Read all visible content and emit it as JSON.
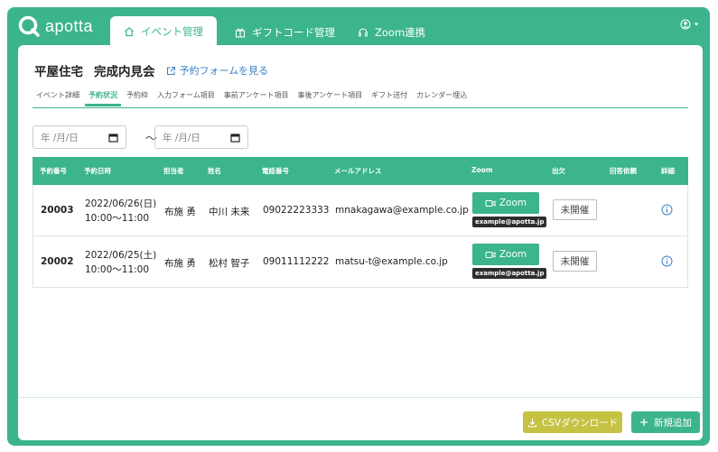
{
  "brand": {
    "name": "apotta"
  },
  "nav": {
    "tabs": [
      {
        "label": "イベント管理",
        "icon": "home-icon",
        "active": true
      },
      {
        "label": "ギフトコード管理",
        "icon": "gift-icon",
        "active": false
      },
      {
        "label": "Zoom連携",
        "icon": "headset-icon",
        "active": false
      }
    ]
  },
  "page": {
    "title": "平屋住宅",
    "title2": "完成内見会",
    "form_link": "予約フォームを見る"
  },
  "subtabs": [
    {
      "label": "イベント詳細",
      "active": false
    },
    {
      "label": "予約状況",
      "active": true
    },
    {
      "label": "予約枠",
      "active": false
    },
    {
      "label": "入力フォーム項目",
      "active": false
    },
    {
      "label": "事前アンケート項目",
      "active": false
    },
    {
      "label": "事後アンケート項目",
      "active": false
    },
    {
      "label": "ギフト送付",
      "active": false
    },
    {
      "label": "カレンダー埋込",
      "active": false
    }
  ],
  "filter": {
    "from_placeholder": "年 /月/日",
    "to_placeholder": "年 /月/日",
    "separator": "〜"
  },
  "table": {
    "headers": {
      "id": "予約番号",
      "datetime": "予約日時",
      "staff": "担当者",
      "name": "姓名",
      "phone": "電話番号",
      "email": "メールアドレス",
      "zoom": "Zoom",
      "attendance": "出欠",
      "response": "回答依頼",
      "detail": "詳細"
    },
    "rows": [
      {
        "id": "20003",
        "date": "2022/06/26(日)",
        "time": "10:00〜11:00",
        "staff": "布施 勇",
        "name": "中川 未来",
        "phone": "09022223333",
        "email": "mnakagawa@example.co.jp",
        "zoom_label": "Zoom",
        "zoom_account": "example@apotta.jp",
        "attendance": "未開催"
      },
      {
        "id": "20002",
        "date": "2022/06/25(土)",
        "time": "10:00〜11:00",
        "staff": "布施 勇",
        "name": "松村 智子",
        "phone": "09011112222",
        "email": "matsu-t@example.co.jp",
        "zoom_label": "Zoom",
        "zoom_account": "example@apotta.jp",
        "attendance": "未開催"
      }
    ]
  },
  "footer": {
    "csv_label": "CSVダウンロード",
    "add_label": "新規追加"
  },
  "colors": {
    "accent": "#3cb48d",
    "csv": "#c5c244",
    "link": "#3a82c4"
  }
}
